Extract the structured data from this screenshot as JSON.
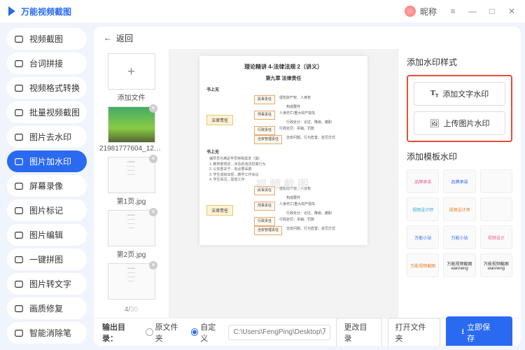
{
  "app_title": "万能视频截图",
  "user_label": "昵称",
  "window_controls": {
    "menu": "≡",
    "min": "—",
    "max": "□",
    "close": "✕"
  },
  "sidebar": {
    "items": [
      {
        "label": "视频截图",
        "icon": "video-icon"
      },
      {
        "label": "台词拼接",
        "icon": "merge-icon"
      },
      {
        "label": "视频格式转换",
        "icon": "convert-icon"
      },
      {
        "label": "批量视频截图",
        "icon": "batch-icon"
      },
      {
        "label": "图片去水印",
        "icon": "remove-wm-icon"
      },
      {
        "label": "图片加水印",
        "icon": "add-wm-icon"
      },
      {
        "label": "屏幕录像",
        "icon": "record-icon"
      },
      {
        "label": "图片标记",
        "icon": "mark-icon"
      },
      {
        "label": "图片编辑",
        "icon": "edit-icon"
      },
      {
        "label": "一键拼图",
        "icon": "puzzle-icon"
      },
      {
        "label": "图片转文字",
        "icon": "ocr-icon"
      },
      {
        "label": "画质修复",
        "icon": "repair-icon"
      },
      {
        "label": "智能消除笔",
        "icon": "erase-icon"
      }
    ],
    "active_index": 5
  },
  "topbar": {
    "back": "返回"
  },
  "thumbs": {
    "add_label": "添加文件",
    "items": [
      {
        "label": "21981777604_12828333…",
        "kind": "photo"
      },
      {
        "label": "第1页.jpg",
        "kind": "doc"
      },
      {
        "label": "第2页.jpg",
        "kind": "doc"
      },
      {
        "label": "",
        "kind": "doc"
      }
    ],
    "current": 4,
    "total": 30
  },
  "preview": {
    "doc_title": "理论精讲 4-法律法规 2（讲义）",
    "chapter": "第九章 法律责任",
    "subheads": [
      "书上无",
      "书上无"
    ],
    "left_labels": [
      "法律责任",
      "法律责任"
    ],
    "tree1": {
      "rows": [
        [
          "民事责任",
          "侵犯财产权、人身权"
        ],
        [
          "",
          "构成要件"
        ],
        [
          "刑事责任",
          "人身伤亡/重大财产损失"
        ],
        [
          "",
          "行政处分：记过、降级、撤职"
        ],
        [
          "行政责任",
          "行政处罚：吊销、罚款"
        ],
        [
          "治安管理责任",
          "治安问题、行为危害、处罚方式"
        ]
      ]
    },
    "midtext": "辅导员为满足学员特殊需求（填）\n1. 教育部规定…涉及的违法犯罪行为\n2. 公安部关于…有必要采取\n3. 学生成绩出现…教学工作会议\n4. 学生情况…思想工作",
    "tree2": {
      "rows": [
        [
          "民事责任",
          "侵犯财产权、人身权"
        ],
        [
          "",
          "构成要件"
        ],
        [
          "刑事责任",
          "人身伤亡/重大财产损失"
        ],
        [
          "",
          "行政处分：记过、降级、撤职"
        ],
        [
          "行政责任",
          "行政处罚：吊销、罚款"
        ],
        [
          "治安管理责任",
          "治安问题、行为危害、处罚方式"
        ]
      ]
    },
    "watermark_sample": "视频截图"
  },
  "rightpanel": {
    "title1": "添加水印样式",
    "btn_text": "添加文字水印",
    "btn_image": "上传图片水印",
    "title2": "添加模板水印",
    "templates": [
      "品牌承诺",
      "品牌承诺",
      "",
      "视频设计师",
      "视频设计师",
      "",
      "万能小站",
      "万能小站",
      "视频设计",
      "万能视频截图",
      "万能视频截图\nwanneng",
      "万能视频截图\nwanneng"
    ]
  },
  "footer": {
    "label": "输出目录：",
    "opt_original": "原文件夹",
    "opt_custom": "自定义",
    "path_placeholder": "C:\\Users\\FengPing\\Desktop\\万能视",
    "btn_change": "更改目录",
    "btn_open": "打开文件夹",
    "btn_save": "立即保存"
  }
}
